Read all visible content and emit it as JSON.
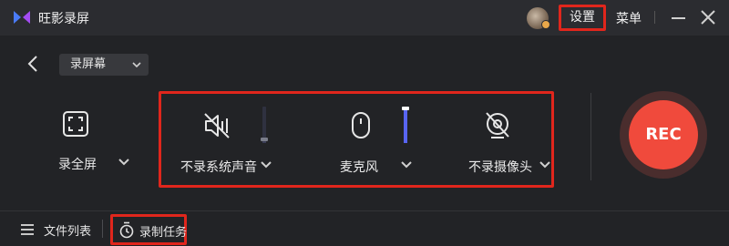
{
  "app": {
    "title": "旺影录屏",
    "accent_color": "#e0261c",
    "rec_color": "#f04a3c"
  },
  "titlebar": {
    "settings_label": "设置",
    "menu_label": "菜单"
  },
  "toolbar": {
    "mode_select": "录屏幕"
  },
  "fullscreen": {
    "label": "录全屏",
    "icon": "fullscreen-icon"
  },
  "devices": [
    {
      "label": "不录系统声音",
      "icon": "speaker-muted-icon",
      "level": 0.1,
      "level_color": "#3a3d55",
      "knob_color": "#7a7d8a"
    },
    {
      "label": "麦克风",
      "icon": "mouse-microphone-icon",
      "level": 1.0,
      "level_color": "#5865f2",
      "knob_color": "#ffffff"
    },
    {
      "label": "不录摄像头",
      "icon": "camera-off-icon"
    }
  ],
  "rec_button": {
    "label": "REC"
  },
  "bottombar": {
    "file_list_label": "文件列表",
    "task_label": "录制任务"
  }
}
